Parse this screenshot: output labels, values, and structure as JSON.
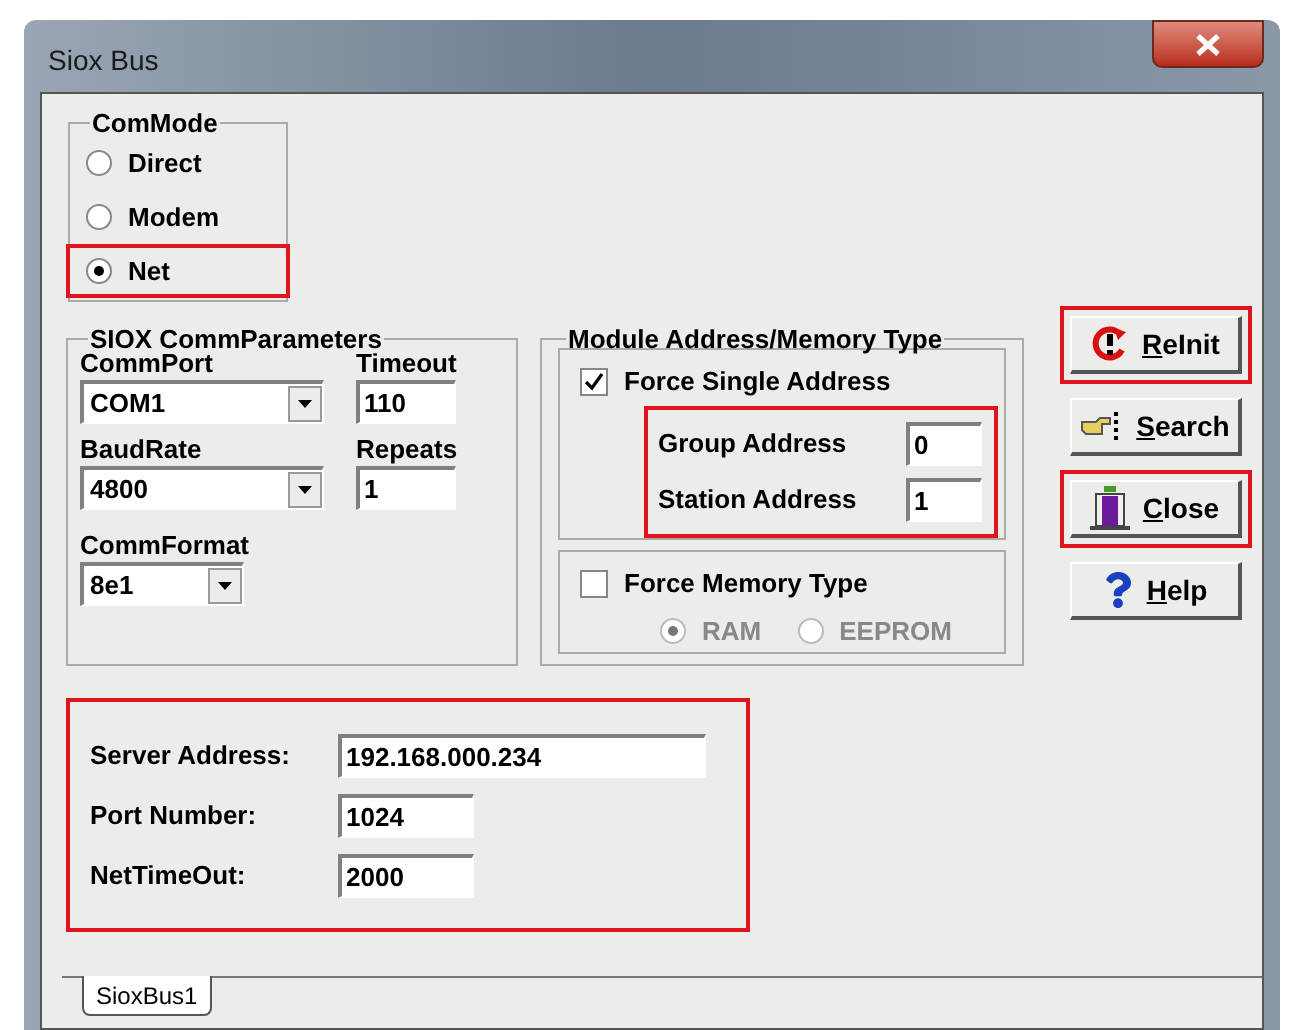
{
  "window": {
    "title": "Siox Bus"
  },
  "com_mode": {
    "title": "ComMode",
    "options": [
      {
        "label": "Direct",
        "selected": false,
        "highlighted": false
      },
      {
        "label": "Modem",
        "selected": false,
        "highlighted": false
      },
      {
        "label": "Net",
        "selected": true,
        "highlighted": true
      }
    ]
  },
  "siox_params": {
    "title": "SIOX CommParameters",
    "comm_port": {
      "label": "CommPort",
      "value": "COM1"
    },
    "timeout": {
      "label": "Timeout",
      "value": "110"
    },
    "baud_rate": {
      "label": "BaudRate",
      "value": "4800"
    },
    "repeats": {
      "label": "Repeats",
      "value": "1"
    },
    "comm_format": {
      "label": "CommFormat",
      "value": "8e1"
    }
  },
  "module": {
    "title": "Module Address/Memory Type",
    "force_single_address": {
      "label": "Force Single Address",
      "checked": true
    },
    "addresses_highlighted": true,
    "addresses": [
      {
        "label": "Group Address",
        "value": "0"
      },
      {
        "label": "Station Address",
        "value": "1"
      }
    ],
    "force_memory_type": {
      "label": "Force Memory Type",
      "checked": false
    },
    "memory_types": [
      {
        "label": "RAM",
        "selected": true,
        "disabled": true
      },
      {
        "label": "EEPROM",
        "selected": false,
        "disabled": true
      }
    ]
  },
  "buttons": [
    {
      "kind": "reinit",
      "label": "ReInit",
      "highlighted": true
    },
    {
      "kind": "search",
      "label": "Search",
      "highlighted": false
    },
    {
      "kind": "close",
      "label": "Close",
      "highlighted": true
    },
    {
      "kind": "help",
      "label": "Help",
      "highlighted": false
    }
  ],
  "net": {
    "highlighted": true,
    "fields": [
      {
        "kind": "address",
        "label": "Server Address:",
        "value": "192.168.000.234"
      },
      {
        "kind": "number",
        "label": "Port Number:",
        "value": "1024"
      },
      {
        "kind": "number",
        "label": "NetTimeOut:",
        "value": "2000"
      }
    ]
  },
  "tabs": [
    {
      "label": "SioxBus1",
      "selected": true
    }
  ]
}
